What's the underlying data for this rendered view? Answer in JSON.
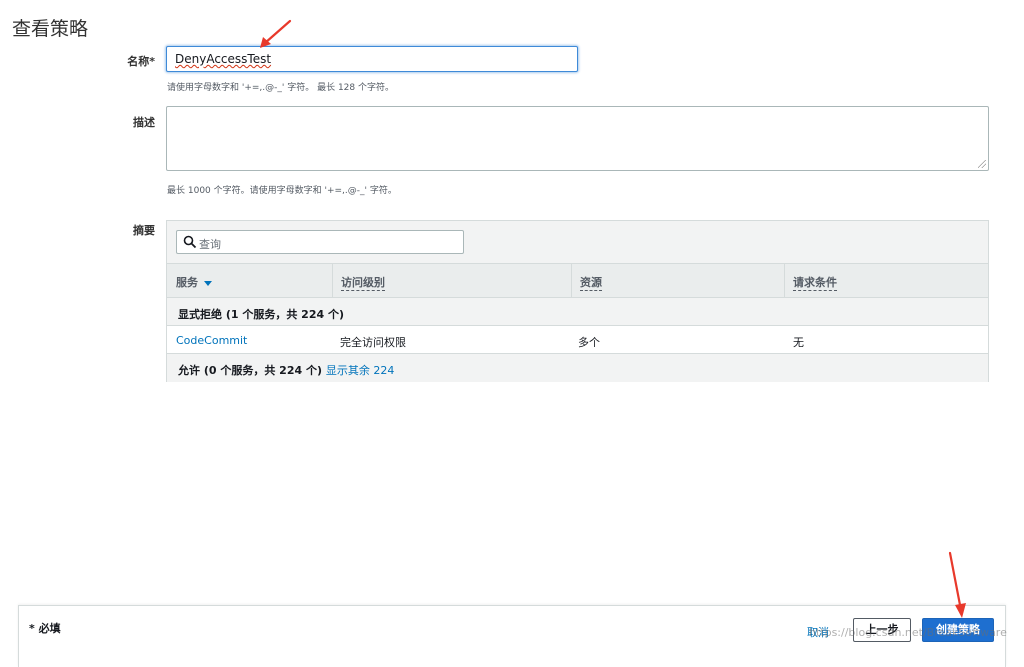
{
  "page": {
    "title": "查看策略"
  },
  "form": {
    "name_label": "名称*",
    "name_value": "DenyAccessTest",
    "name_hint": "请使用字母数字和 '+=,.@-_' 字符。 最长 128 个字符。",
    "desc_label": "描述",
    "desc_hint": "最长 1000 个字符。请使用字母数字和 '+=,.@-_' 字符。",
    "summary_label": "摘要"
  },
  "summary": {
    "search_placeholder": "查询",
    "columns": [
      "服务",
      "访问级别",
      "资源",
      "请求条件"
    ],
    "deny_group": "显式拒绝 (1 个服务，共 224 个)",
    "rows": [
      {
        "service": "CodeCommit",
        "access_level": "完全访问权限",
        "resource": "多个",
        "condition": "无"
      }
    ],
    "allow_group": "允许 (0 个服务，共 224 个)",
    "show_rest_link": "显示其余 224"
  },
  "footer": {
    "required_note": "* 必填",
    "cancel_label": "取消",
    "prev_label": "上一步",
    "create_label": "创建策略",
    "watermark": "https://blog.csdn.net/BreakSoftware"
  },
  "colors": {
    "accent": "#0073bb",
    "primary_button": "#1e6fd0",
    "arrow": "#e8392b"
  },
  "icons": [
    "search-icon",
    "sort-caret-icon",
    "resize-grip-icon",
    "annotation-arrow"
  ]
}
